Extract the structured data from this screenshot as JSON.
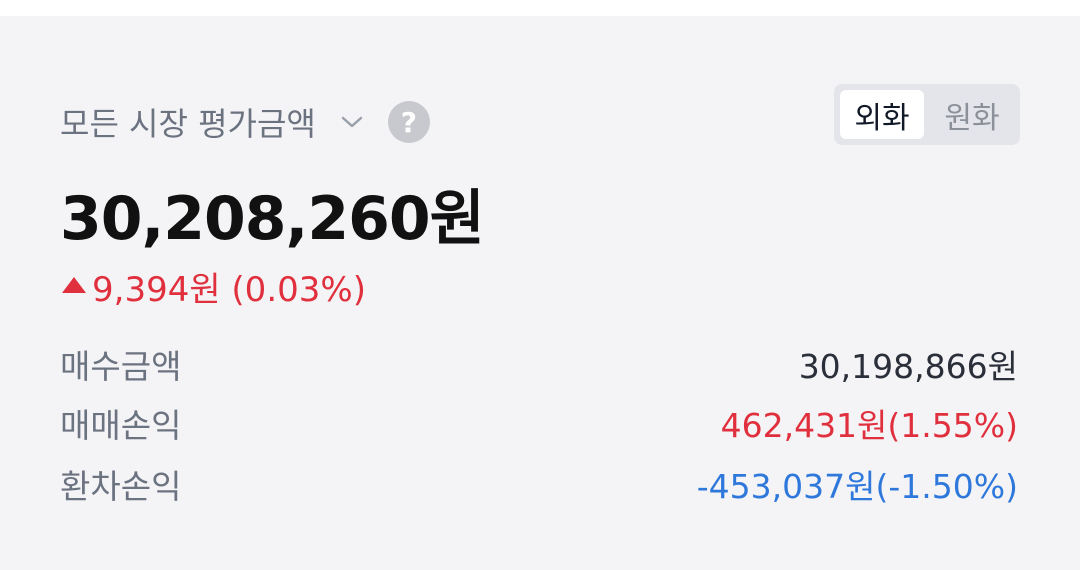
{
  "header": {
    "title": "모든 시장 평가금액",
    "toggle": {
      "options": [
        "외화",
        "원화"
      ],
      "selected": "외화"
    }
  },
  "total": {
    "amount": "30,208,260원",
    "change": "9,394원 (0.03%)",
    "change_direction": "up"
  },
  "details": [
    {
      "label": "매수금액",
      "value": "30,198,866원"
    },
    {
      "label": "매매손익",
      "value": "462,431원(1.55%)"
    },
    {
      "label": "환차손익",
      "value": "-453,037원(-1.50%)"
    }
  ],
  "colors": {
    "positive": "#e0303e",
    "negative": "#2f78db",
    "background": "#f4f4f6"
  },
  "icons": {
    "chevron": "chevron-down-icon",
    "help": "question-icon",
    "increase": "triangle-up-icon"
  }
}
